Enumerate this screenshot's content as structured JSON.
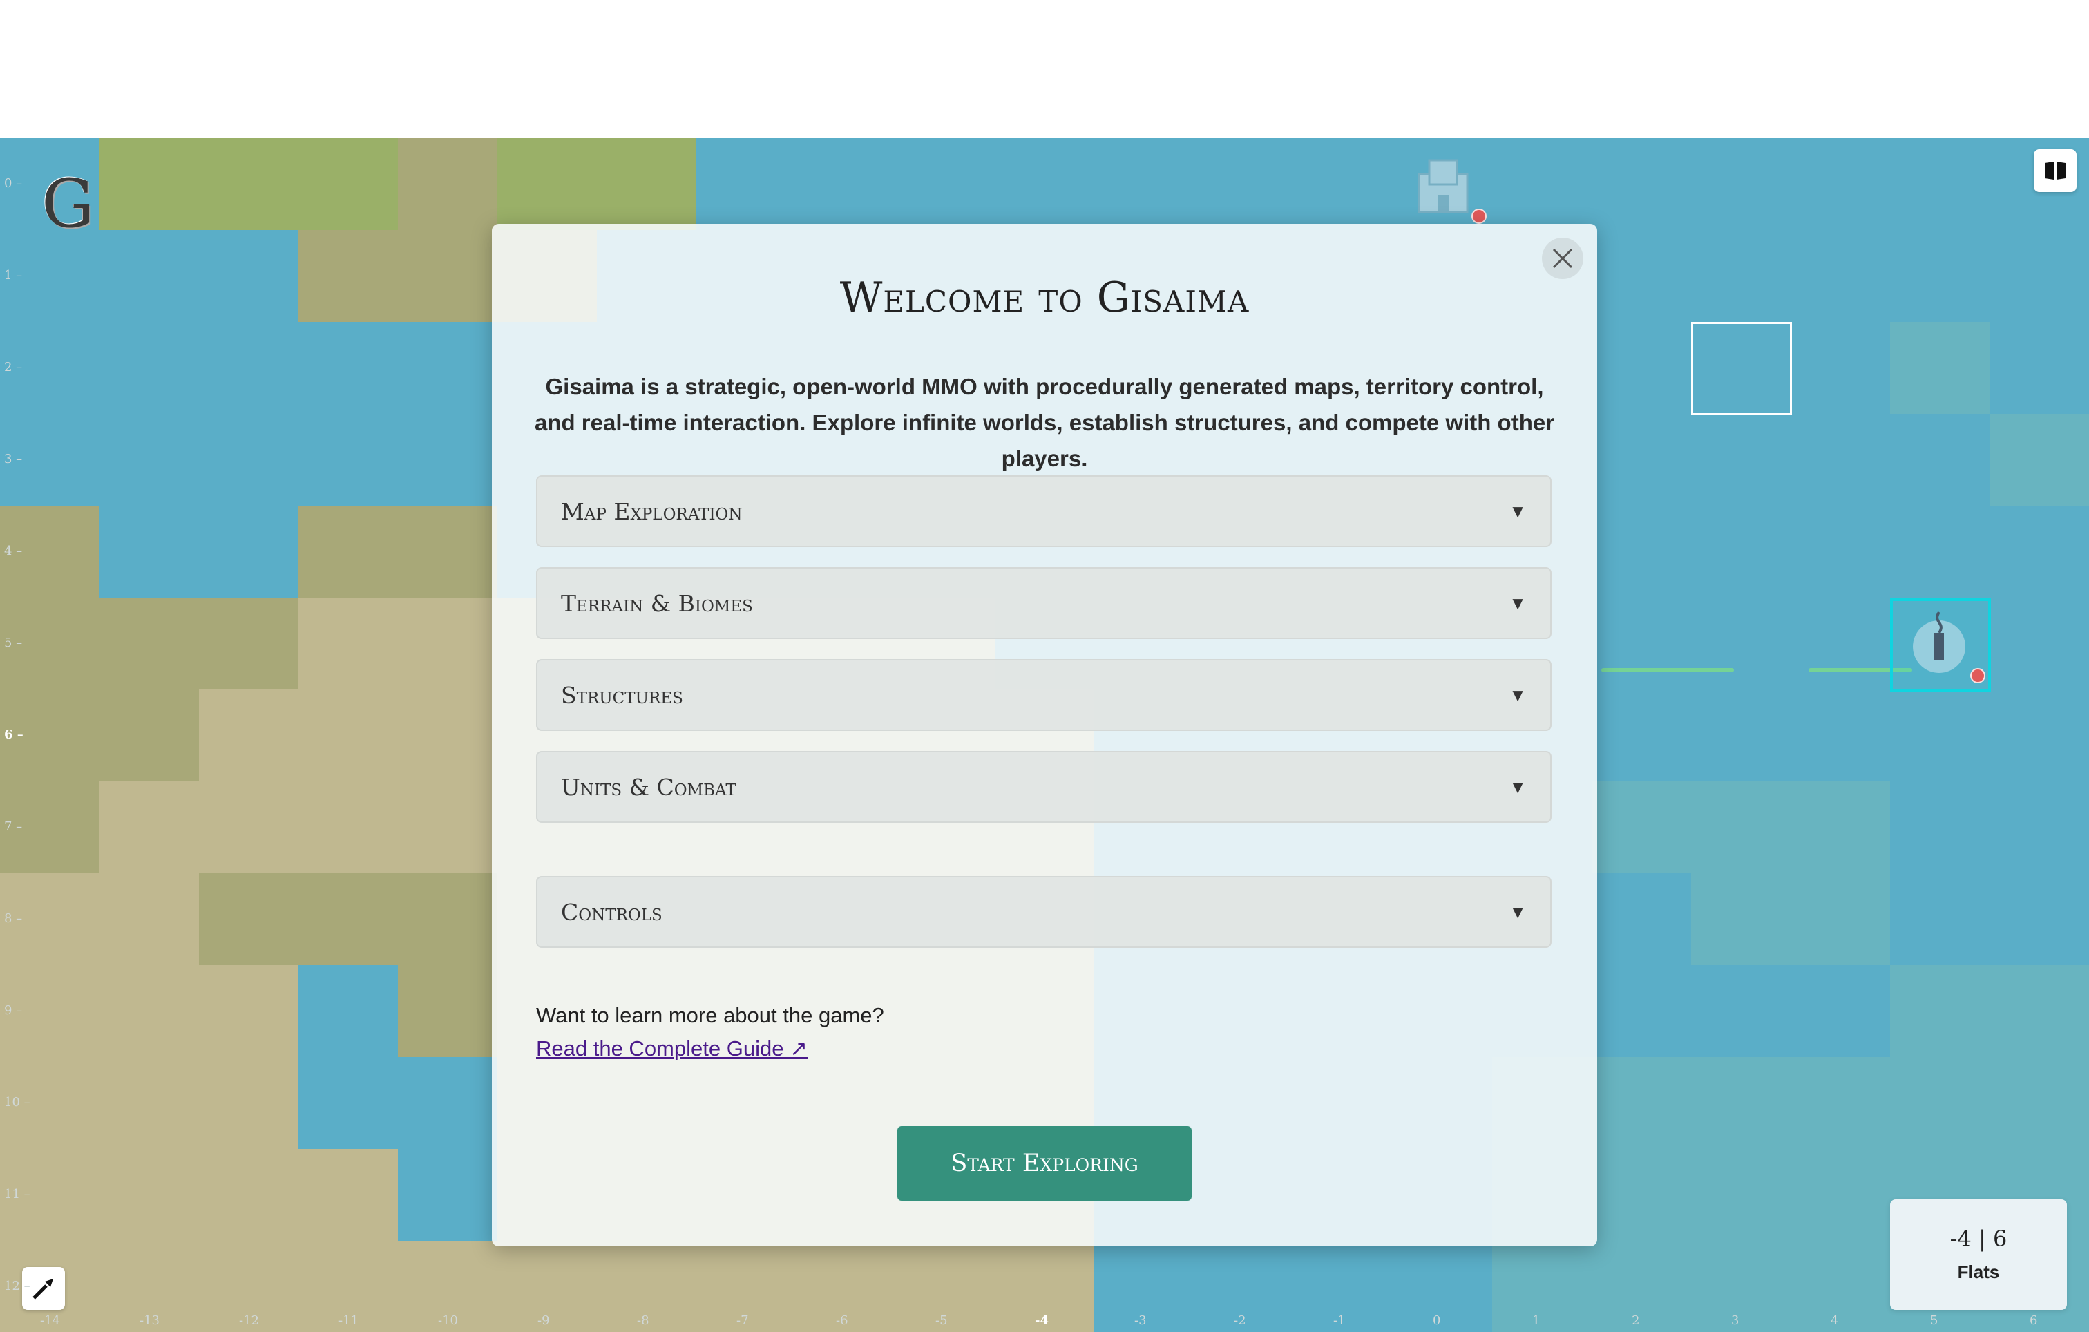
{
  "app": {
    "logo_letter": "G"
  },
  "map": {
    "y_axis": [
      "0",
      "1",
      "2",
      "3",
      "4",
      "5",
      "6",
      "7",
      "8",
      "9",
      "10",
      "11",
      "12"
    ],
    "x_axis": [
      "-14",
      "-13",
      "-12",
      "-11",
      "-10",
      "-9",
      "-8",
      "-7",
      "-6",
      "-5",
      "-4",
      "-3",
      "-2",
      "-1",
      "0",
      "1",
      "2",
      "3",
      "4",
      "5",
      "6"
    ],
    "active_x": "-4",
    "active_y": "6",
    "colors": {
      "water": "#5aaec8",
      "shallow": "#68b4c0",
      "grass": "#9ab068",
      "plains": "#a8a878",
      "sand": "#c0b890"
    }
  },
  "coords_panel": {
    "position": "-4 | 6",
    "terrain": "Flats"
  },
  "modal": {
    "title": "Welcome to Gisaima",
    "intro": "Gisaima is a strategic, open-world MMO with procedurally generated maps, territory control, and real-time interaction. Explore infinite worlds, establish structures, and compete with other players.",
    "sections": [
      {
        "label": "Map Exploration"
      },
      {
        "label": "Terrain & Biomes"
      },
      {
        "label": "Structures"
      },
      {
        "label": "Units & Combat"
      },
      {
        "label": "Controls"
      }
    ],
    "learn_more": "Want to learn more about the game?",
    "guide_link": "Read the Complete Guide ↗",
    "start_button": "Start Exploring"
  },
  "icons": {
    "close": "close-icon",
    "map_toggle": "book-icon",
    "tool": "torch-icon",
    "arrow": "chevron-down-icon"
  }
}
